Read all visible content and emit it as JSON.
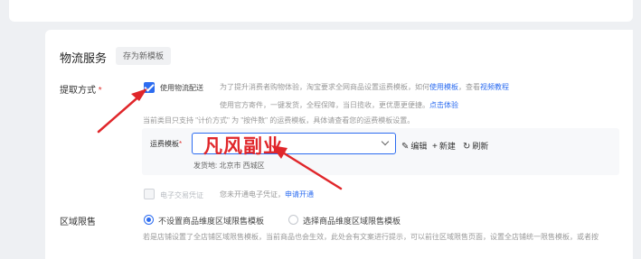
{
  "section": {
    "title": "物流服务",
    "template_tag": "存为新模板"
  },
  "pickup": {
    "label": "提取方式",
    "required_mark": "*",
    "option_label": "使用物流配送",
    "option_checked": true,
    "desc1": "为了提升消费者购物体验，淘宝要求全网商品设置运费模板，如何",
    "desc1_link": "使用模板",
    "desc1_tail": "，查看",
    "desc1_link2": "视频教程",
    "desc2": "使用官方寄件，一键发货，全程保障，当日揽收，更优惠更便捷。",
    "desc2_link": "点击体验",
    "note": "当前类目只支持 \"计价方式\" 为 \"按件数\" 的运费模板，具体请查看您的运费模板设置。"
  },
  "shipping": {
    "label": "运费模板",
    "required_mark": "*",
    "edit": "编辑",
    "new": "新建",
    "refresh": "刷新",
    "origin": "发货地: 北京市 西城区"
  },
  "ecert": {
    "label": "电子交易凭证",
    "desc": "您未开通电子凭证，",
    "link": "申请开通"
  },
  "region": {
    "label": "区域限售",
    "option1": "不设置商品维度区域限售模板",
    "option2": "选择商品维度区域限售模板",
    "note": "若是店铺设置了全店铺区域限售模板，当前商品也会生效，此处会有文案进行提示，可以前往区域限售页面，设置全店铺统一限售模板，或者按"
  },
  "overlay": {
    "watermark": "凡风副业",
    "arrow_color": "#e0262a"
  },
  "colors": {
    "accent": "#2c6cf0",
    "required": "#e0322f"
  }
}
